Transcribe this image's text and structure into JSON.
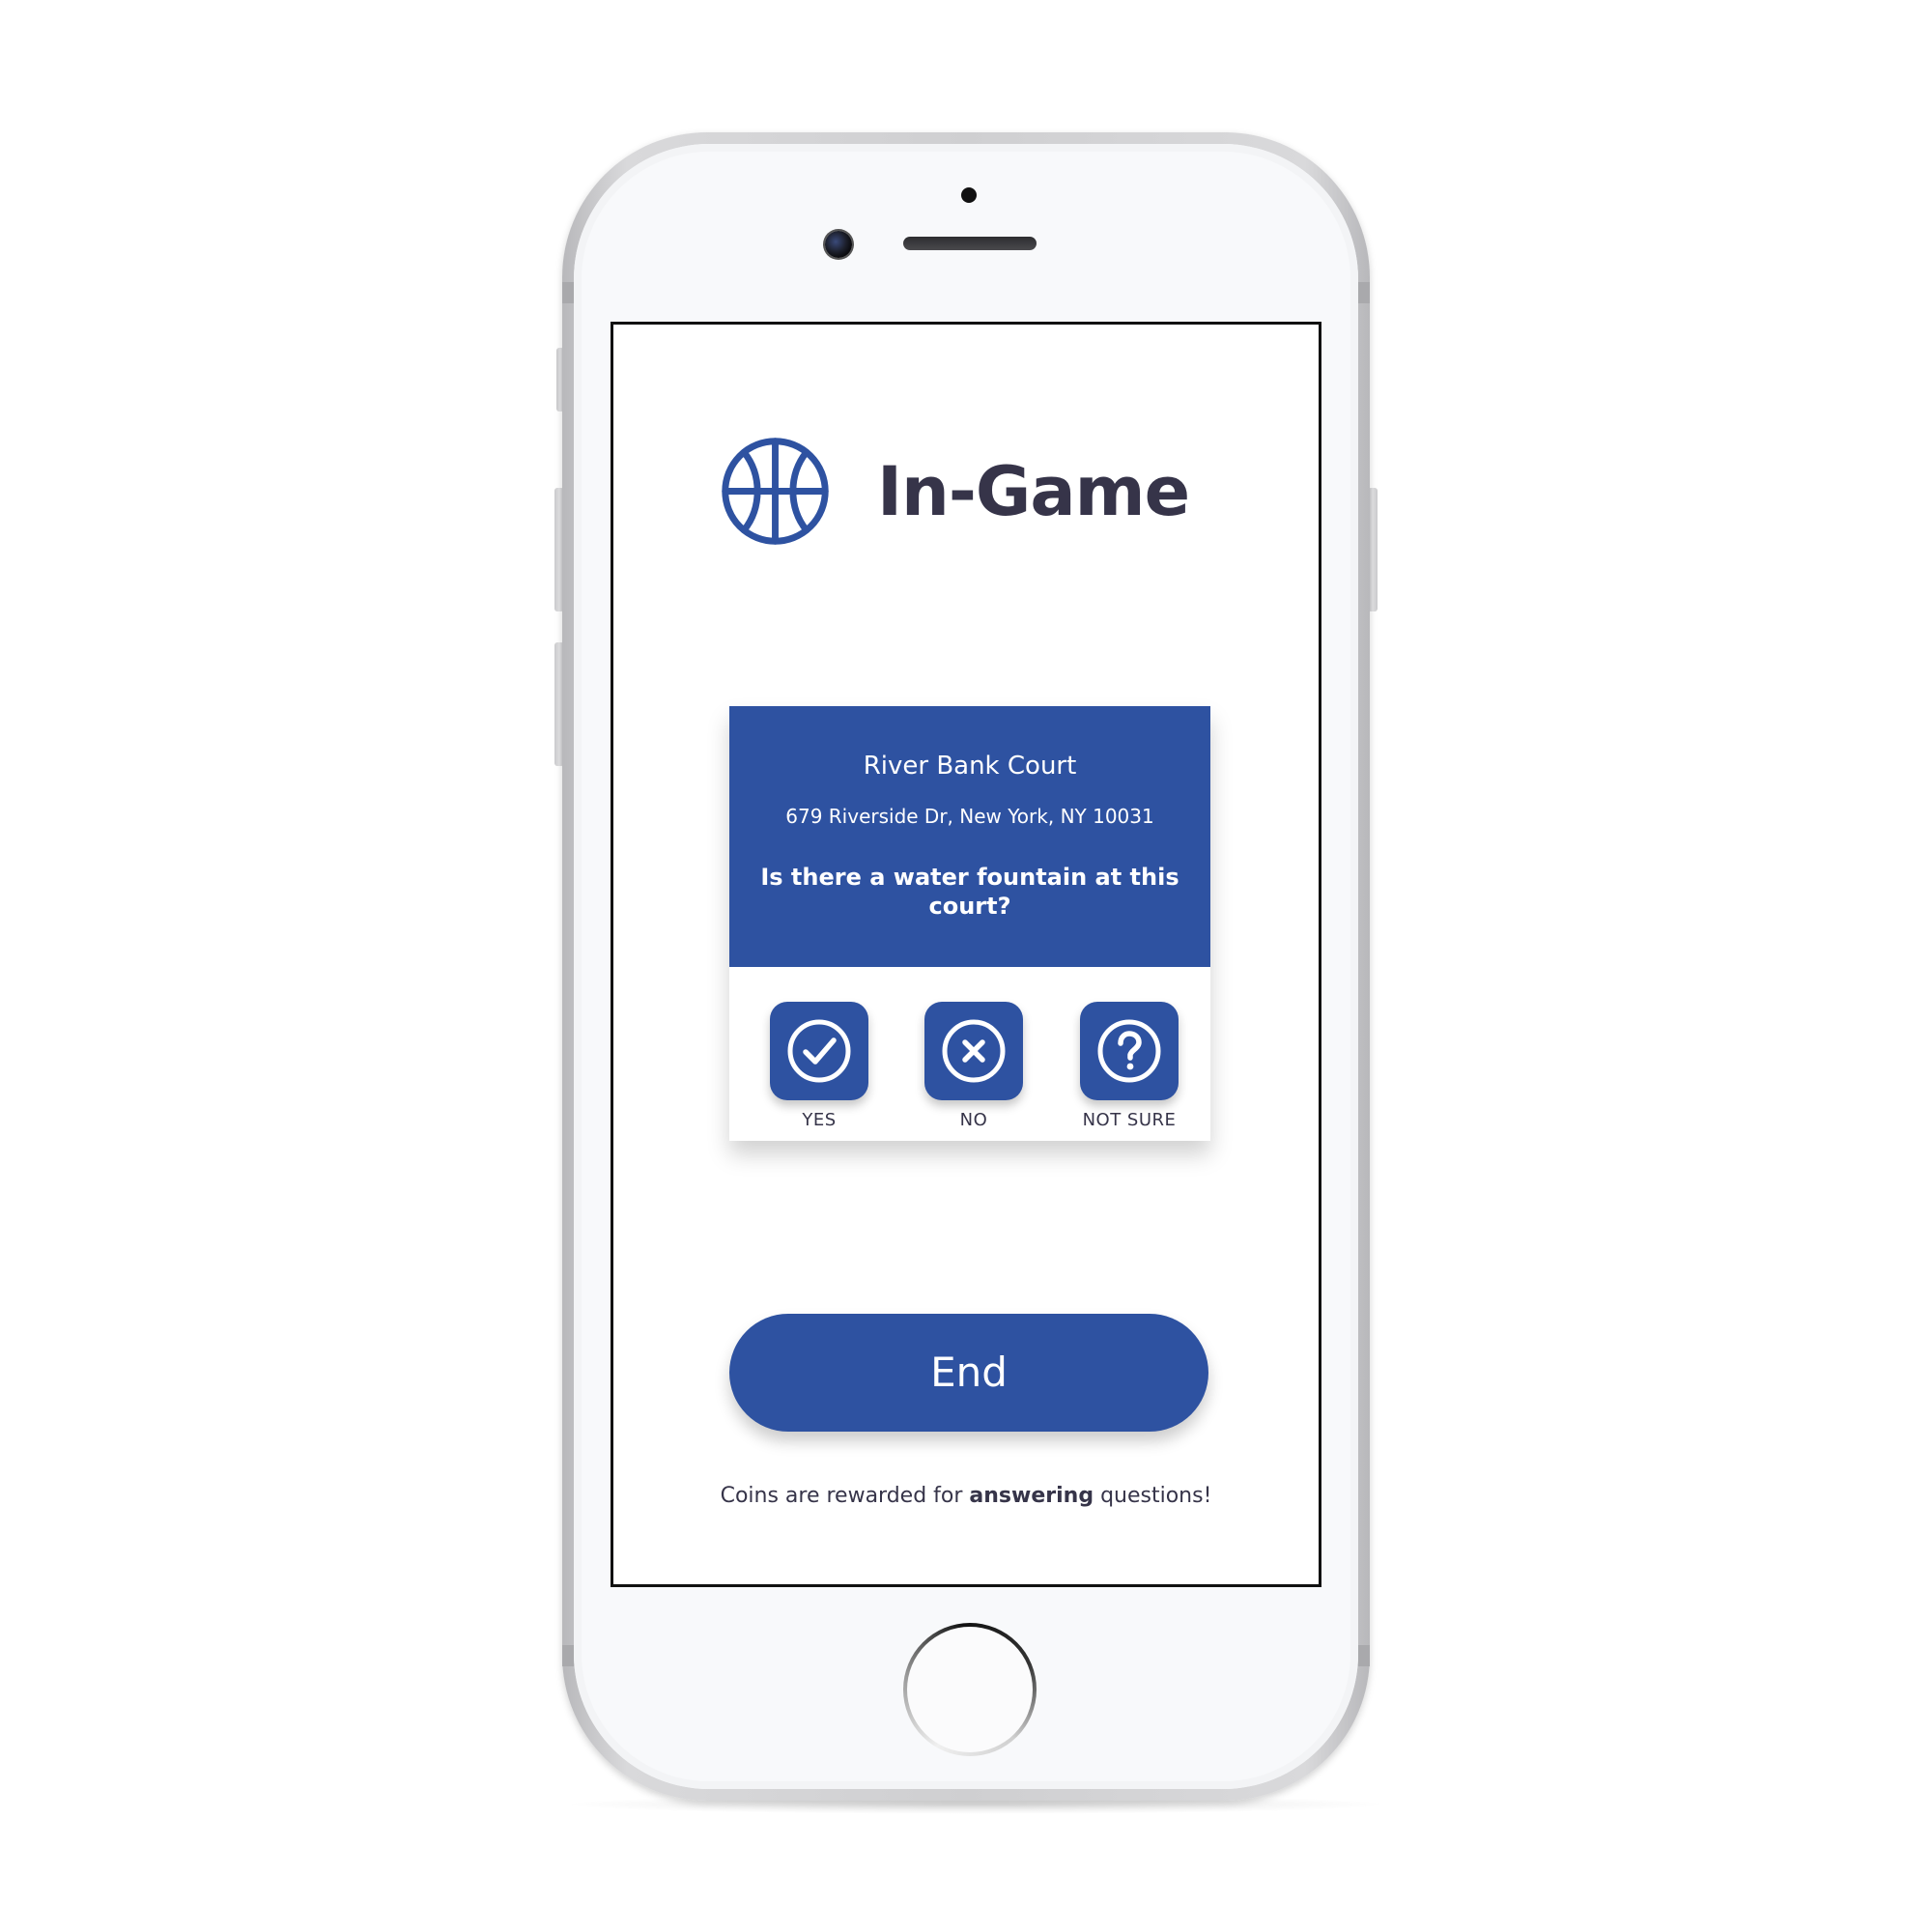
{
  "app": {
    "title": "In-Game",
    "logo_icon": "basketball-icon",
    "accent_color": "#2e52a1",
    "text_color": "#363449"
  },
  "card": {
    "court_name": "River Bank Court",
    "address": "679 Riverside Dr, New York, NY 10031",
    "question": "Is there a water fountain at this court?",
    "answers": [
      {
        "label": "YES",
        "icon": "check-circle-icon"
      },
      {
        "label": "NO",
        "icon": "x-circle-icon"
      },
      {
        "label": "NOT SURE",
        "icon": "question-circle-icon"
      }
    ]
  },
  "end_button": {
    "label": "End"
  },
  "footer": {
    "before": "Coins are rewarded for ",
    "emphasis": "answering",
    "after": " questions!"
  }
}
